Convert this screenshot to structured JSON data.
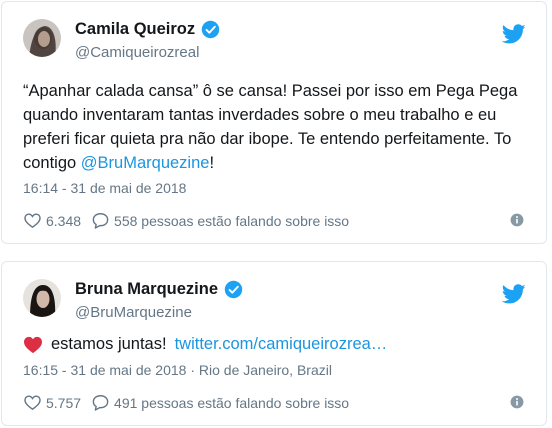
{
  "tweets": [
    {
      "name": "Camila Queiroz",
      "handle": "@Camiqueirozreal",
      "text_before": "“Apanhar calada cansa” ô se cansa! Passei por isso em Pega Pega quando inventaram tantas inverdades sobre o meu trabalho e eu preferi ficar quieta pra não dar ibope. Te entendo perfeitamente. To contigo ",
      "mention": "@BruMarquezine",
      "text_after": "!",
      "timestamp": "16:14 - 31 de mai de 2018",
      "likes": "6.348",
      "talking": "558 pessoas estão falando sobre isso"
    },
    {
      "name": "Bruna Marquezine",
      "handle": "@BruMarquezine",
      "text": "estamos juntas!",
      "link": "twitter.com/camiqueirozrea…",
      "timestamp": "16:15 - 31 de mai de 2018 · Rio de Janeiro, Brazil",
      "likes": "5.757",
      "talking": "491 pessoas estão falando sobre isso"
    }
  ],
  "colors": {
    "accent": "#1da1f2",
    "link": "#1b95e0",
    "muted": "#657786",
    "heart": "#e0245e"
  },
  "icons": [
    "twitter-bird-icon",
    "verified-badge-icon",
    "like-heart-icon",
    "reply-bubble-icon",
    "info-icon",
    "red-heart-emoji-icon"
  ]
}
